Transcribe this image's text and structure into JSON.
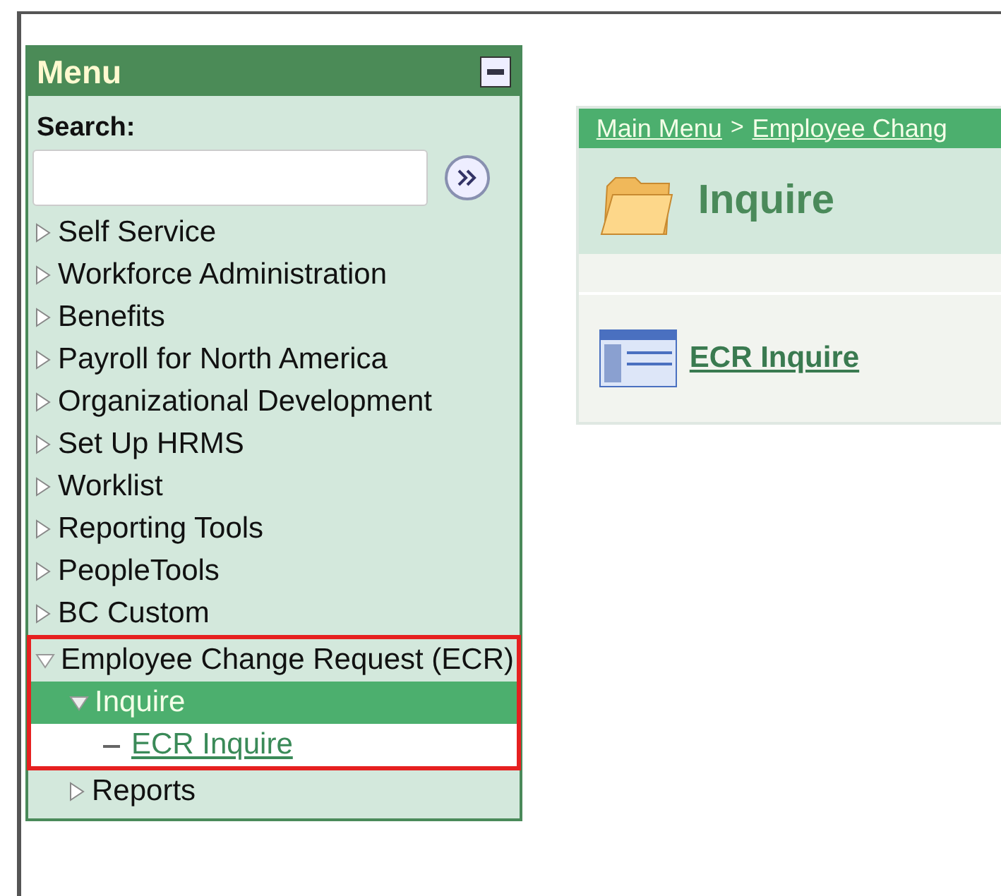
{
  "menu": {
    "title": "Menu",
    "search": {
      "label": "Search:"
    },
    "items": [
      {
        "label": "Self Service",
        "expanded": false
      },
      {
        "label": "Workforce Administration",
        "expanded": false
      },
      {
        "label": "Benefits",
        "expanded": false
      },
      {
        "label": "Payroll for North America",
        "expanded": false
      },
      {
        "label": "Organizational Development",
        "expanded": false
      },
      {
        "label": "Set Up HRMS",
        "expanded": false
      },
      {
        "label": "Worklist",
        "expanded": false
      },
      {
        "label": "Reporting Tools",
        "expanded": false
      },
      {
        "label": "PeopleTools",
        "expanded": false
      },
      {
        "label": "BC Custom",
        "expanded": false
      },
      {
        "label": "Employee Change Request (ECR)",
        "expanded": true,
        "highlighted": true,
        "children": [
          {
            "label": "Inquire",
            "expanded": true,
            "selected": true,
            "highlighted": true,
            "children": [
              {
                "label": "ECR Inquire",
                "kind": "link",
                "selected": true
              }
            ]
          },
          {
            "label": "Reports",
            "expanded": false,
            "selected": false,
            "highlighted": false
          }
        ]
      }
    ]
  },
  "content": {
    "breadcrumb": [
      "Main Menu",
      "Employee Chang"
    ],
    "breadcrumb_separator": ">",
    "title": "Inquire",
    "links": [
      "ECR Inquire"
    ]
  }
}
